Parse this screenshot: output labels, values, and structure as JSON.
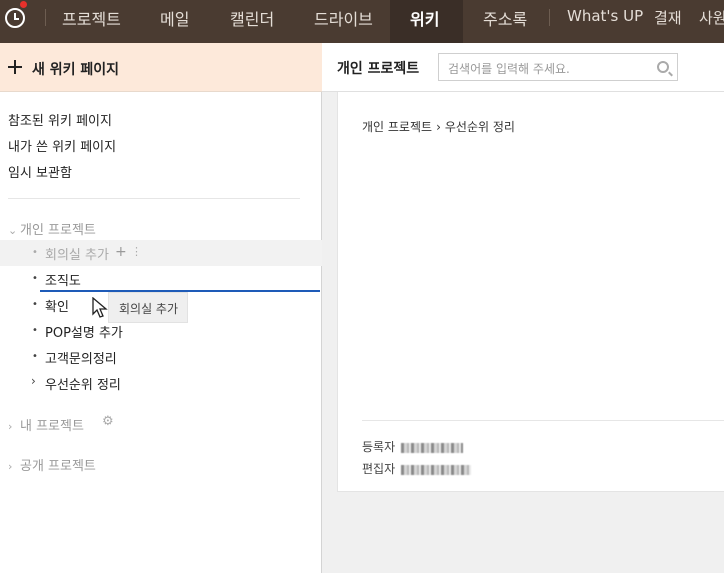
{
  "nav": {
    "items": [
      "프로젝트",
      "메일",
      "캘린더",
      "드라이브",
      "위키",
      "주소록",
      "What's UP",
      "결재",
      "사원"
    ],
    "active": "위키"
  },
  "left": {
    "new_page_label": "새 위키 페이지",
    "links": [
      "참조된 위키 페이지",
      "내가 쓴 위키 페이지",
      "임시 보관함"
    ],
    "section_personal": "개인 프로젝트",
    "tree": [
      {
        "label": "회의실 추가",
        "state": "dragging"
      },
      {
        "label": "조직도"
      },
      {
        "label": "확인"
      },
      {
        "label": "POP설명 추가"
      },
      {
        "label": "고객문의정리"
      },
      {
        "label": "우선순위 정리",
        "collapsed": true
      }
    ],
    "drag_tooltip": "회의실 추가",
    "section_my": "내 프로젝트",
    "section_public": "공개 프로젝트"
  },
  "right": {
    "title": "개인 프로젝트",
    "search_placeholder": "검색어를 입력해 주세요.",
    "breadcrumb": [
      "개인 프로젝트",
      "우선순위 정리"
    ],
    "registrant_label": "등록자",
    "editor_label": "편집자"
  },
  "colors": {
    "nav_bg": "#4a3b31",
    "new_page_bg": "#fde9da",
    "drop_line": "#1e5bb8",
    "notification_dot": "#e8312b"
  }
}
